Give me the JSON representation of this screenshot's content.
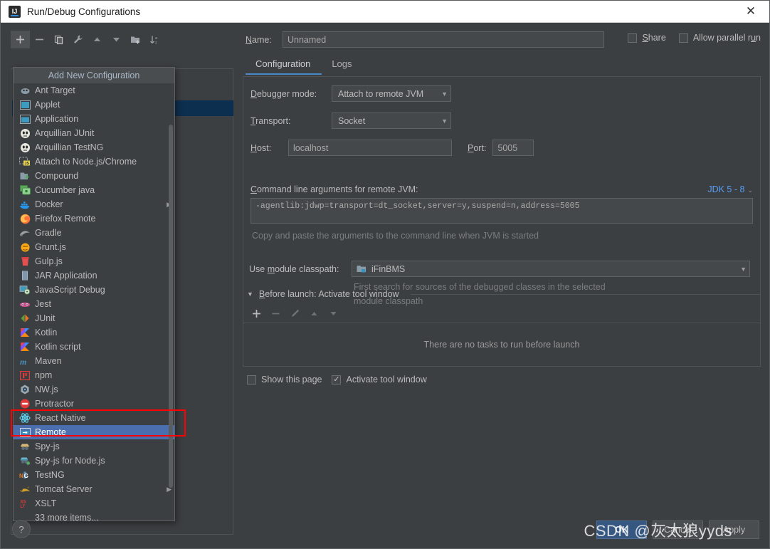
{
  "window": {
    "title": "Run/Debug Configurations",
    "close_label": "✕",
    "app_icon": "IJ"
  },
  "toolbar": {
    "items": [
      {
        "name": "add-configuration-button",
        "icon": "plus-icon",
        "active": true
      },
      {
        "name": "remove-configuration-button",
        "icon": "minus-icon",
        "active": false
      },
      {
        "name": "copy-configuration-button",
        "icon": "copy-icon",
        "active": false
      },
      {
        "name": "edit-templates-button",
        "icon": "wrench-icon",
        "active": false
      },
      {
        "name": "move-up-button",
        "icon": "arrow-up-icon",
        "active": false
      },
      {
        "name": "move-down-button",
        "icon": "arrow-down-icon",
        "active": false
      },
      {
        "name": "move-into-folder-button",
        "icon": "folder-add-icon",
        "active": false
      },
      {
        "name": "sort-configurations-button",
        "icon": "sort-az-icon",
        "active": false
      }
    ]
  },
  "popup": {
    "header": "Add New Configuration",
    "more_items": "33 more items...",
    "selected": "Remote",
    "items": [
      {
        "label": "Ant Target",
        "icon": "ant-icon",
        "submenu": false
      },
      {
        "label": "Applet",
        "icon": "applet-icon",
        "submenu": false
      },
      {
        "label": "Application",
        "icon": "application-icon",
        "submenu": false
      },
      {
        "label": "Arquillian JUnit",
        "icon": "arquillian-icon",
        "submenu": false
      },
      {
        "label": "Arquillian TestNG",
        "icon": "arquillian-icon",
        "submenu": false
      },
      {
        "label": "Attach to Node.js/Chrome",
        "icon": "nodejs-attach-icon",
        "submenu": false
      },
      {
        "label": "Compound",
        "icon": "compound-icon",
        "submenu": false
      },
      {
        "label": "Cucumber java",
        "icon": "cucumber-icon",
        "submenu": false
      },
      {
        "label": "Docker",
        "icon": "docker-icon",
        "submenu": true
      },
      {
        "label": "Firefox Remote",
        "icon": "firefox-icon",
        "submenu": false
      },
      {
        "label": "Gradle",
        "icon": "gradle-icon",
        "submenu": false
      },
      {
        "label": "Grunt.js",
        "icon": "grunt-icon",
        "submenu": false
      },
      {
        "label": "Gulp.js",
        "icon": "gulp-icon",
        "submenu": false
      },
      {
        "label": "JAR Application",
        "icon": "jar-icon",
        "submenu": false
      },
      {
        "label": "JavaScript Debug",
        "icon": "javascript-debug-icon",
        "submenu": false
      },
      {
        "label": "Jest",
        "icon": "jest-icon",
        "submenu": false
      },
      {
        "label": "JUnit",
        "icon": "junit-icon",
        "submenu": false
      },
      {
        "label": "Kotlin",
        "icon": "kotlin-icon",
        "submenu": false
      },
      {
        "label": "Kotlin script",
        "icon": "kotlin-icon",
        "submenu": false
      },
      {
        "label": "Maven",
        "icon": "maven-icon",
        "submenu": false
      },
      {
        "label": "npm",
        "icon": "npm-icon",
        "submenu": false
      },
      {
        "label": "NW.js",
        "icon": "nwjs-icon",
        "submenu": false
      },
      {
        "label": "Protractor",
        "icon": "protractor-icon",
        "submenu": false
      },
      {
        "label": "React Native",
        "icon": "react-icon",
        "submenu": false
      },
      {
        "label": "Remote",
        "icon": "remote-icon",
        "submenu": false
      },
      {
        "label": "Spy-js",
        "icon": "spyjs-icon",
        "submenu": false
      },
      {
        "label": "Spy-js for Node.js",
        "icon": "spyjs-node-icon",
        "submenu": false
      },
      {
        "label": "TestNG",
        "icon": "testng-icon",
        "submenu": false
      },
      {
        "label": "Tomcat Server",
        "icon": "tomcat-icon",
        "submenu": true
      },
      {
        "label": "XSLT",
        "icon": "xslt-icon",
        "submenu": false
      }
    ]
  },
  "form": {
    "name_label": "Name:",
    "name_mnemonic": "N",
    "name_value": "Unnamed",
    "share_label": "Share",
    "share_mnemonic": "S",
    "share_checked": false,
    "parallel_label": "Allow parallel run",
    "parallel_checked": false,
    "tabs": [
      {
        "label": "Configuration",
        "active": true
      },
      {
        "label": "Logs",
        "active": false
      }
    ],
    "debugger_mode_label": "Debugger mode:",
    "debugger_mode_mnemonic": "D",
    "debugger_mode_value": "Attach to remote JVM",
    "transport_label": "Transport:",
    "transport_mnemonic": "T",
    "transport_value": "Socket",
    "host_label": "Host:",
    "host_mnemonic": "H",
    "host_value": "localhost",
    "port_label": "Port:",
    "port_mnemonic": "P",
    "port_value": "5005",
    "cmdline_label": "Command line arguments for remote JVM:",
    "cmdline_mnemonic": "C",
    "jdk_link": "JDK 5 - 8",
    "cmdline_value": "-agentlib:jdwp=transport=dt_socket,server=y,suspend=n,address=5005",
    "copy_hint": "Copy and paste the arguments to the command line when JVM is started",
    "module_classpath_label_a": "Use ",
    "module_classpath_mnemonic": "m",
    "module_classpath_label_b": "odule classpath:",
    "module_classpath_value": "iFinBMS",
    "module_hint_line1": "First search for sources of the debugged classes in the selected",
    "module_hint_line2": "module classpath"
  },
  "before_launch": {
    "header": "Before launch: Activate tool window",
    "header_mnemonic": "B",
    "empty_text": "There are no tasks to run before launch",
    "toolbar": [
      {
        "name": "add-task-button",
        "icon": "plus-icon",
        "enabled": true
      },
      {
        "name": "remove-task-button",
        "icon": "minus-icon",
        "enabled": false
      },
      {
        "name": "edit-task-button",
        "icon": "pencil-icon",
        "enabled": false
      },
      {
        "name": "move-task-up-button",
        "icon": "arrow-up-icon",
        "enabled": false
      },
      {
        "name": "move-task-down-button",
        "icon": "arrow-down-icon",
        "enabled": false
      }
    ],
    "show_page_label": "Show this page",
    "show_page_checked": false,
    "activate_label": "Activate tool window",
    "activate_checked": true
  },
  "footer": {
    "help_label": "?",
    "ok_label": "OK",
    "cancel_label": "Cancel",
    "apply_label": "Apply"
  },
  "watermark": "CSDN @灰太狼yyds",
  "colors": {
    "accent": "#4b6eaf",
    "tab_underline": "#4a88c7",
    "link": "#589df6",
    "annotation": "#ff0000",
    "ok_button": "#365880"
  }
}
